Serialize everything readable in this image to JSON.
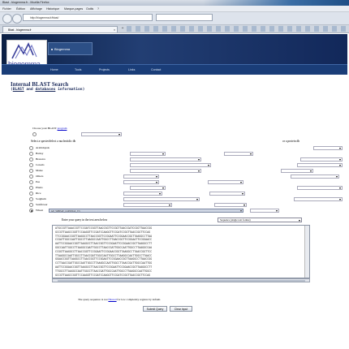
{
  "window": {
    "title": "Blast - biogemma.fr - Mozilla Firefox"
  },
  "menubar": {
    "items": [
      "Fichier",
      "Édition",
      "Affichage",
      "Historique",
      "Marque-pages",
      "Outils",
      "?"
    ]
  },
  "navbar": {
    "url": "http://biogemma.fr/blast/"
  },
  "tab": {
    "label": "Blast - biogemma.fr"
  },
  "banner": {
    "logo_text": "biogemma",
    "brand_tab": "Biogemma",
    "nav_items": [
      "Home",
      "Tools",
      "Projects",
      "Links",
      "Contact"
    ]
  },
  "page": {
    "title": "Internal BLAST Search",
    "subtitle_pre": "(",
    "subtitle_blast": "BLAST",
    "subtitle_and": " and ",
    "subtitle_db": "databases",
    "subtitle_post": " information)",
    "choose_label": "Choose your BLAST ",
    "choose_link": "program",
    "species_head": "Select a speciesSelect a nucleotidic db",
    "protein_head": "or a protein db",
    "species": [
      {
        "label": "Arabidopsis",
        "selected": false
      },
      {
        "label": "Barley",
        "selected": false
      },
      {
        "label": "Brassica",
        "selected": false
      },
      {
        "label": "Cereals",
        "selected": false
      },
      {
        "label": "Maize",
        "selected": false
      },
      {
        "label": "Others",
        "selected": false
      },
      {
        "label": "Pea",
        "selected": false
      },
      {
        "label": "Plants",
        "selected": false
      },
      {
        "label": "Rice",
        "selected": false
      },
      {
        "label": "Sorghum",
        "selected": false
      },
      {
        "label": "Sunflower",
        "selected": false
      },
      {
        "label": "Wheat",
        "selected": true
      }
    ],
    "wheat_db": "GP_WHEAT_CONTIGS_V3",
    "query_head": "Enter your query in the text area below",
    "seq_dropdown": "Sequence (single text format)",
    "sequence_lines": [
      "ATGCCGTTAAACCGTTCCGATCCGGTTAACCGGTTCCGGTTAACCGATCCGGTTAACCGG",
      "GCCGTTAAGCCGGTTCCAAGGTTCCGATCCAAGGTTCCGATCCGGTTAACCGGTTCCAG",
      "TTCCGGAACCGGTTAAGGCCTTAACCGGTTCCGGAATTCCGGAACCGGTTAAGGCCTTAA",
      "CCGATTGGCCAATTGGCCTTAAGGCCAATTGGCCTTAACCGGTTCCGGAATTCCGGAACC",
      "AATTCCGGAACCGGTTAAGGCCTTAACCGGTTCCGGAATTCCGGAACCGGTTAAGGCCTT",
      "GGCCAATTGGCCTTAAGGCCAATTGGCCTTAACCGATTGGCCAATTGGCCTTAAGGCCAA",
      "CCGGTTAAGGCCTTAACCGGTTCCGGAATTCCGGAACCGGTTAAGGCCTTAACCGGTTCC",
      "TTAAGGCCAATTGGCCTTAACCGATTGGCCAATTGGCCTTAAGGCCAATTGGCCTTAACC",
      "GGAACCGGTTAAGGCCTTAACCGGTTCCGGAATTCCGGAACCGGTTAAGGCCTTAACCGG",
      "CCTTAACCGATTGGCCAATTGGCCTTAAGGCCAATTGGCCTTAACCGATTGGCCAATTGG",
      "AATTCCGGAACCGGTTAAGGCCTTAACCGGTTCCGGAATTCCGGAACCGGTTAAGGCCTT",
      "TTGGCCTTAAGGCCAATTGGCCTTAACCGATTGGCCAATTGGCCTTAAGGCCAATTGGCC",
      "GCCGTTAAGCCGGTTCCAAGGTTCCGATCCAAGGTTCCGATCCGGTTAACCGGTTCCAG"
    ],
    "note_pre": "The query sequence is not ",
    "note_link": "filtered",
    "note_post": " for low complexity regions by default.",
    "submit_label": "Submit Query",
    "clear_label": "Clear input"
  },
  "colors": {
    "banner": "#12285a",
    "heading": "#1b2a5a",
    "link": "#0000cc"
  }
}
